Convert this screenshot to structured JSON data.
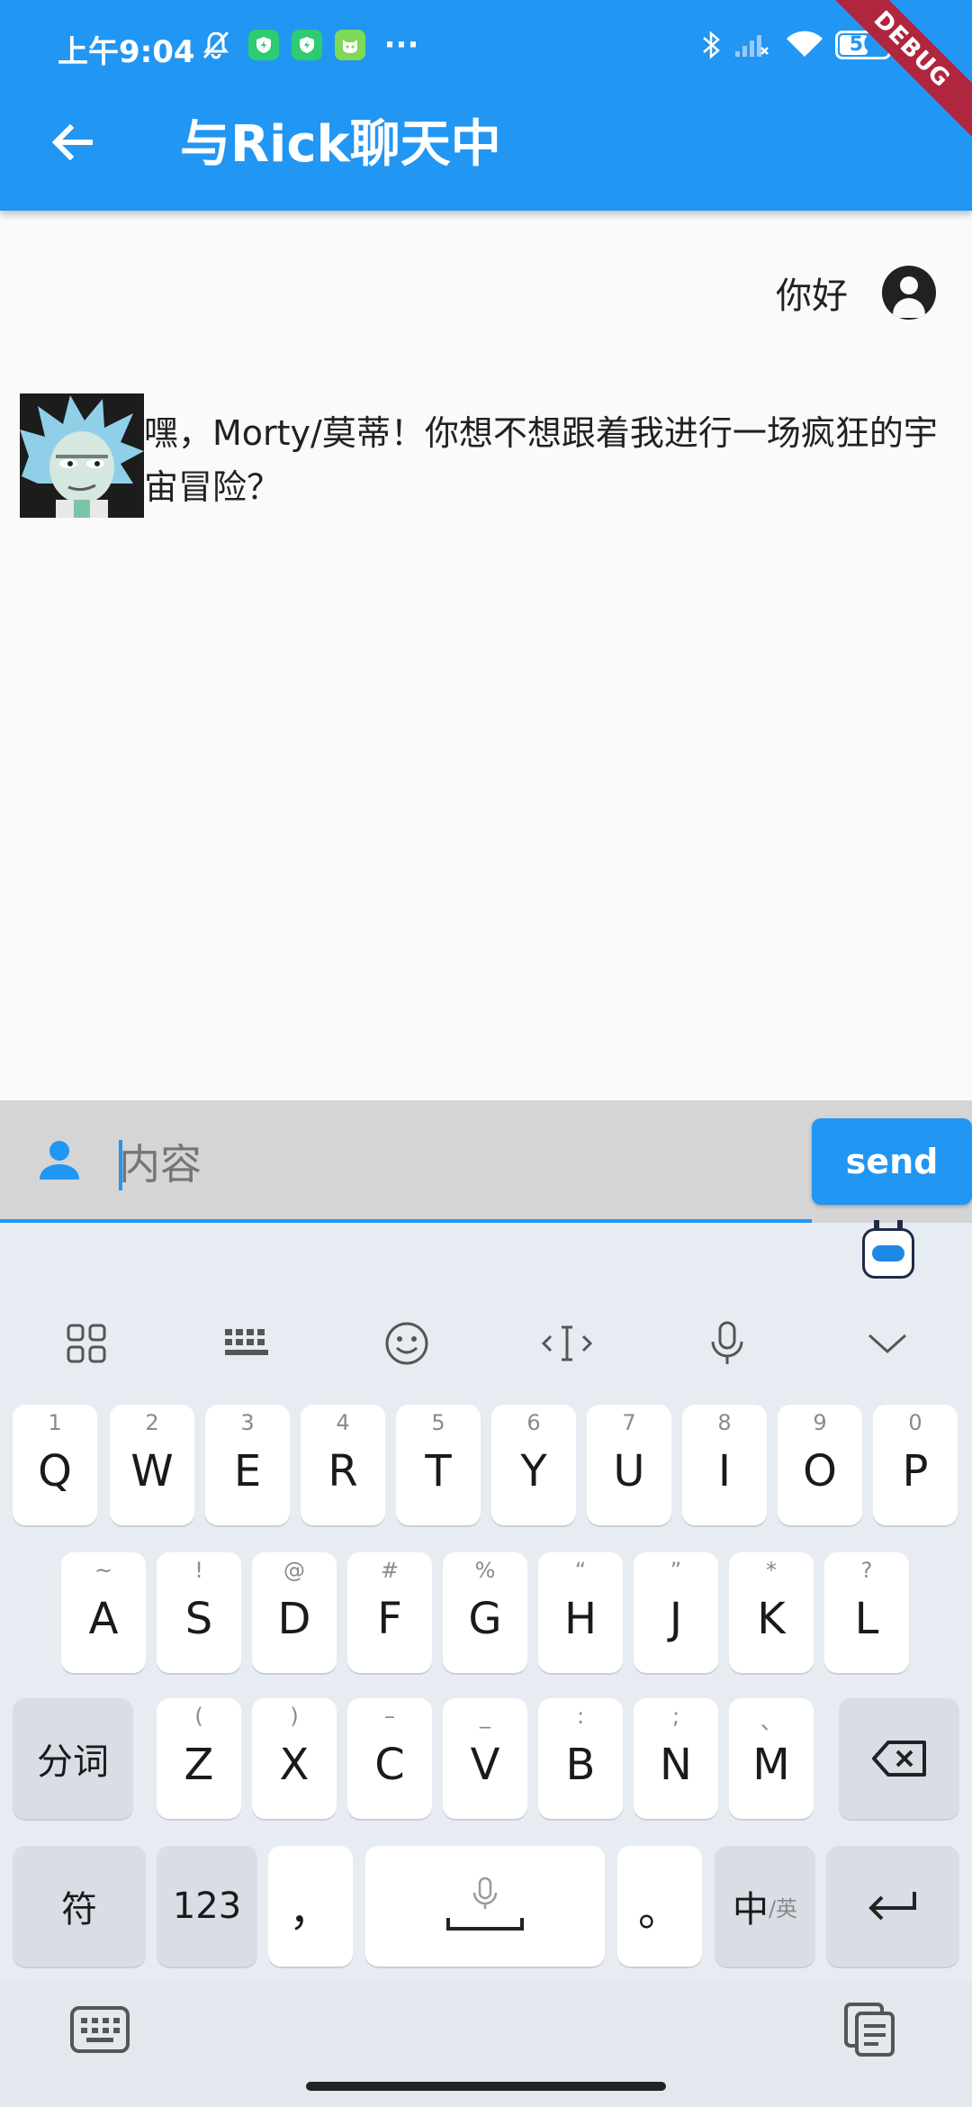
{
  "status_bar": {
    "time": "上午9:04",
    "battery": "56",
    "icons": [
      "mute-bell-icon",
      "app-shield-icon",
      "app-shield-icon",
      "app-cat-icon",
      "more-dots-icon",
      "bluetooth-icon",
      "signal-icon",
      "wifi-icon",
      "battery-icon"
    ],
    "more": "···",
    "battery_level": 0.56
  },
  "debug_banner": "DEBUG",
  "app_bar": {
    "title": "与Rick聊天中",
    "back_icon": "arrow-back-icon",
    "color": "#2196f3"
  },
  "messages": [
    {
      "from": "me",
      "text": "你好",
      "avatar_icon": "account-circle-icon"
    },
    {
      "from": "rick",
      "text": "嘿，Morty/莫蒂！你想不想跟着我进行一场疯狂的宇宙冒险？",
      "avatar": "rick-avatar-image"
    }
  ],
  "composer": {
    "placeholder": "内容",
    "value": "",
    "send_label": "send",
    "icon": "person-icon"
  },
  "keyboard": {
    "toolbar": [
      "grid-apps-icon",
      "keyboard-layout-icon",
      "emoji-icon",
      "text-cursor-icon",
      "microphone-icon",
      "collapse-chevron-icon"
    ],
    "row1": [
      {
        "hint": "1",
        "key": "Q"
      },
      {
        "hint": "2",
        "key": "W"
      },
      {
        "hint": "3",
        "key": "E"
      },
      {
        "hint": "4",
        "key": "R"
      },
      {
        "hint": "5",
        "key": "T"
      },
      {
        "hint": "6",
        "key": "Y"
      },
      {
        "hint": "7",
        "key": "U"
      },
      {
        "hint": "8",
        "key": "I"
      },
      {
        "hint": "9",
        "key": "O"
      },
      {
        "hint": "0",
        "key": "P"
      }
    ],
    "row2": [
      {
        "hint": "~",
        "key": "A"
      },
      {
        "hint": "!",
        "key": "S"
      },
      {
        "hint": "@",
        "key": "D"
      },
      {
        "hint": "#",
        "key": "F"
      },
      {
        "hint": "%",
        "key": "G"
      },
      {
        "hint": "“",
        "key": "H"
      },
      {
        "hint": "”",
        "key": "J"
      },
      {
        "hint": "*",
        "key": "K"
      },
      {
        "hint": "?",
        "key": "L"
      }
    ],
    "row3_left": "分词",
    "row3": [
      {
        "hint": "(",
        "key": "Z"
      },
      {
        "hint": ")",
        "key": "X"
      },
      {
        "hint": "–",
        "key": "C"
      },
      {
        "hint": "_",
        "key": "V"
      },
      {
        "hint": ":",
        "key": "B"
      },
      {
        "hint": ";",
        "key": "N"
      },
      {
        "hint": "、",
        "key": "M"
      }
    ],
    "row4": {
      "symbols": "符",
      "numbers": "123",
      "comma": "，",
      "period": "。",
      "lang_main": "中",
      "lang_sub": "/英"
    },
    "bottom": [
      "keyboard-switch-icon",
      "clipboard-icon"
    ]
  }
}
